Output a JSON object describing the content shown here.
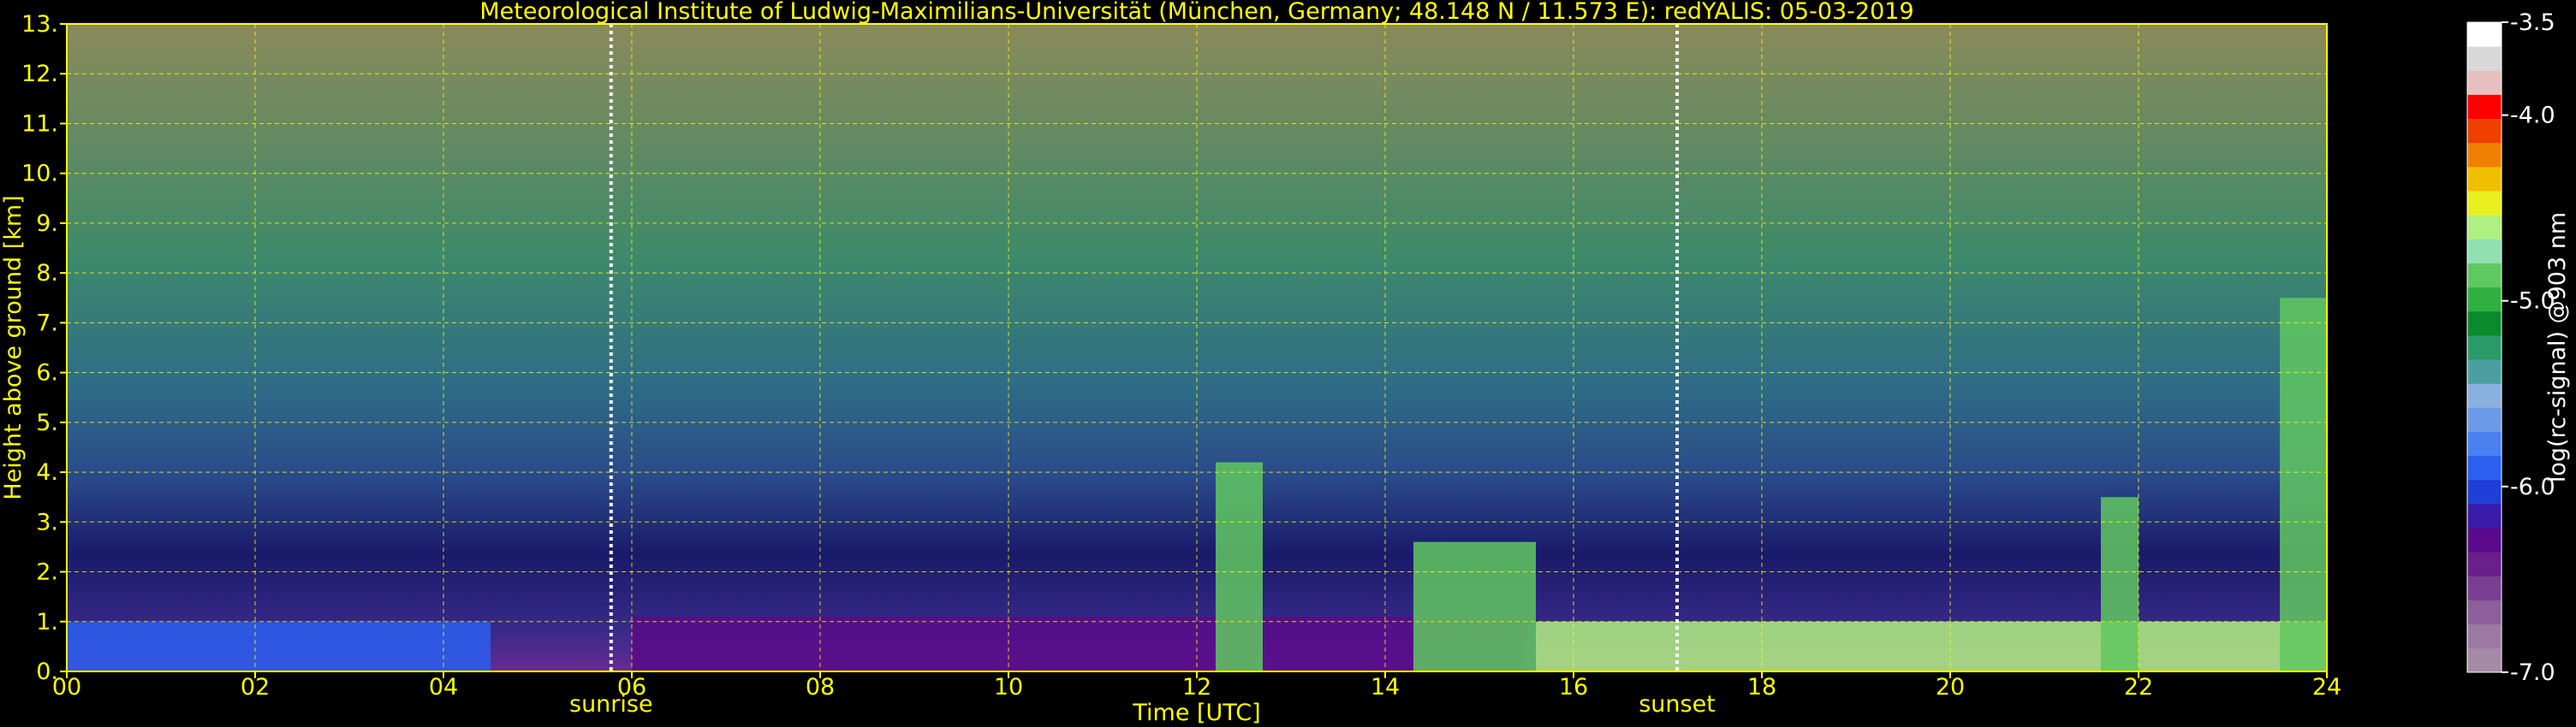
{
  "chart_data": {
    "type": "heatmap",
    "title": "Meteorological Institute of Ludwig-Maximilians-Universität (München, Germany; 48.148 N / 11.573 E):    redYALIS: 05-03-2019",
    "xlabel": "Time [UTC]",
    "ylabel": "Height above ground [km]",
    "xlim": [
      0,
      24
    ],
    "ylim": [
      0,
      13
    ],
    "x_ticks": [
      {
        "value": 0,
        "label": "00"
      },
      {
        "value": 2,
        "label": "02"
      },
      {
        "value": 4,
        "label": "04"
      },
      {
        "value": 6,
        "label": "06"
      },
      {
        "value": 8,
        "label": "08"
      },
      {
        "value": 10,
        "label": "10"
      },
      {
        "value": 12,
        "label": "12"
      },
      {
        "value": 14,
        "label": "14"
      },
      {
        "value": 16,
        "label": "16"
      },
      {
        "value": 18,
        "label": "18"
      },
      {
        "value": 20,
        "label": "20"
      },
      {
        "value": 22,
        "label": "22"
      },
      {
        "value": 24,
        "label": "24"
      }
    ],
    "y_ticks": [
      {
        "value": 0,
        "label": "0."
      },
      {
        "value": 1,
        "label": "1."
      },
      {
        "value": 2,
        "label": "2."
      },
      {
        "value": 3,
        "label": "3."
      },
      {
        "value": 4,
        "label": "4."
      },
      {
        "value": 5,
        "label": "5."
      },
      {
        "value": 6,
        "label": "6."
      },
      {
        "value": 7,
        "label": "7."
      },
      {
        "value": 8,
        "label": "8."
      },
      {
        "value": 9,
        "label": "9."
      },
      {
        "value": 10,
        "label": "10."
      },
      {
        "value": 11,
        "label": "11."
      },
      {
        "value": 12,
        "label": "12."
      },
      {
        "value": 13,
        "label": "13."
      }
    ],
    "grid": true,
    "events": [
      {
        "label": "sunrise",
        "time": 5.78
      },
      {
        "label": "sunset",
        "time": 17.1
      }
    ],
    "colorbar": {
      "label": "log(rc-signal) @903 nm",
      "min": -7.0,
      "max": -3.5,
      "ticks": [
        {
          "value": -3.5,
          "label": "-3.5"
        },
        {
          "value": -4.0,
          "label": "-4.0"
        },
        {
          "value": -5.0,
          "label": "-5.0"
        },
        {
          "value": -6.0,
          "label": "-6.0"
        },
        {
          "value": -7.0,
          "label": "-7.0"
        }
      ],
      "colors": [
        "#a58aa8",
        "#9a7aa3",
        "#8c5f9a",
        "#7a3f90",
        "#6a1f8a",
        "#5a0a8a",
        "#3a1aa8",
        "#1f3fd8",
        "#2a5ff0",
        "#4a80f0",
        "#6a9ae8",
        "#8ab0e0",
        "#4aa0a0",
        "#2a9a6a",
        "#0a8a2a",
        "#30b040",
        "#60c860",
        "#90e0b0",
        "#b0f080",
        "#e8f020",
        "#f0c000",
        "#f08000",
        "#f04000",
        "#ff0000",
        "#e8c0c0",
        "#d8d8d8",
        "#ffffff"
      ]
    },
    "features": [
      {
        "kind": "boundary-layer-aerosol",
        "t_start": 0.0,
        "t_end": 4.5,
        "z_top": 1.0,
        "level": -5.9
      },
      {
        "kind": "boundary-layer-aerosol",
        "t_start": 6.0,
        "t_end": 15.5,
        "z_top": 1.1,
        "level": -6.3
      },
      {
        "kind": "strong-near-surface",
        "t_start": 15.6,
        "t_end": 24.0,
        "z_top": 1.0,
        "level": -4.6
      },
      {
        "kind": "cloud",
        "t_start": 14.3,
        "t_end": 15.6,
        "z_top": 2.6,
        "level": -4.8
      },
      {
        "kind": "cloud",
        "t_start": 12.2,
        "t_end": 12.7,
        "z_top": 4.2,
        "level": -4.9
      },
      {
        "kind": "cloud",
        "t_start": 21.6,
        "t_end": 22.0,
        "z_top": 3.5,
        "level": -4.9
      },
      {
        "kind": "cloud",
        "t_start": 23.5,
        "t_end": 24.0,
        "z_top": 7.5,
        "level": -4.9
      }
    ]
  }
}
